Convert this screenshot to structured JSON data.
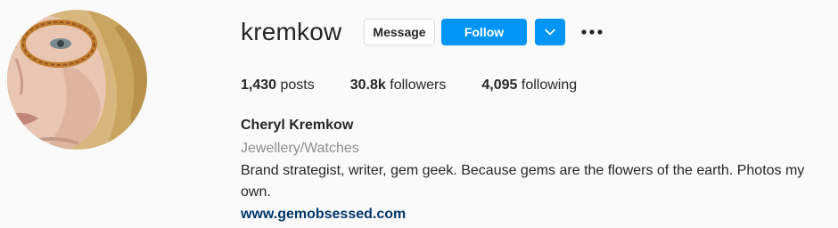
{
  "profile": {
    "username": "kremkow",
    "buttons": {
      "message_label": "Message",
      "follow_label": "Follow"
    },
    "stats": {
      "posts_count": "1,430",
      "posts_label": "posts",
      "followers_count": "30.8k",
      "followers_label": "followers",
      "following_count": "4,095",
      "following_label": "following"
    },
    "full_name": "Cheryl Kremkow",
    "category": "Jewellery/Watches",
    "bio": "Brand strategist, writer, gem geek. Because gems are the flowers of the earth. Photos my own.",
    "website": "www.gemobsessed.com"
  },
  "icons": {
    "dropdown": "chevron-down-icon",
    "more": "more-options-icon"
  },
  "colors": {
    "accent": "#0095f6",
    "link": "#00376b",
    "muted": "#8e8e8e",
    "text": "#262626",
    "background": "#fafafa"
  }
}
